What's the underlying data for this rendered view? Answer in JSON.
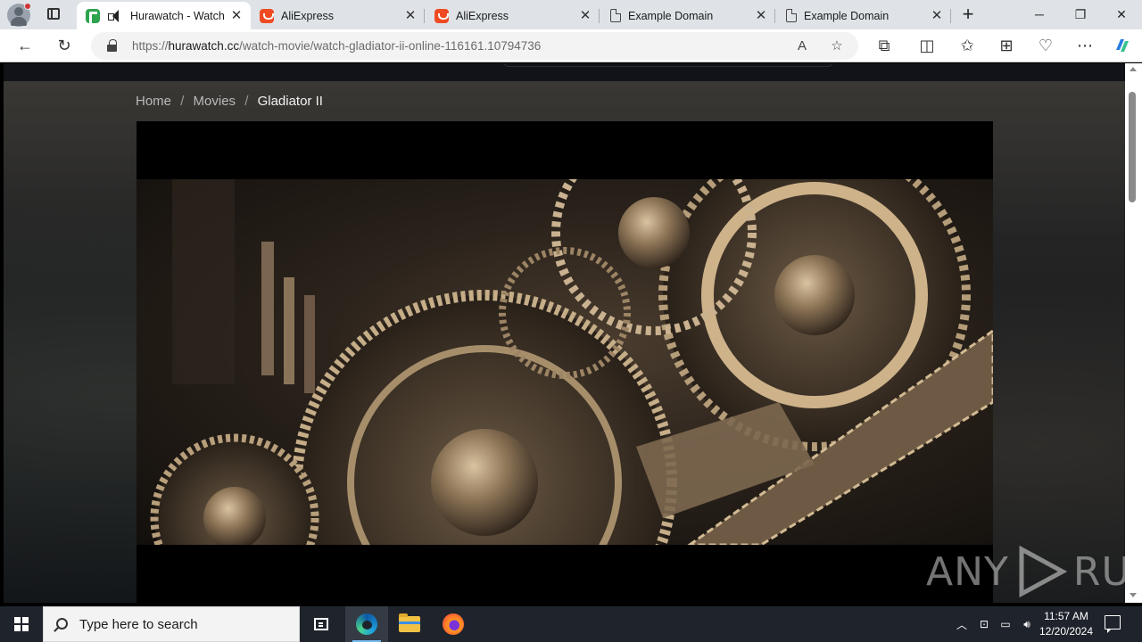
{
  "browser": {
    "tabs": [
      {
        "title": "Hurawatch - Watch",
        "icon": "hurawatch-favicon",
        "active": true,
        "audio": true
      },
      {
        "title": "AliExpress",
        "icon": "aliexpress-favicon",
        "active": false
      },
      {
        "title": "AliExpress",
        "icon": "aliexpress-favicon",
        "active": false
      },
      {
        "title": "Example Domain",
        "icon": "document-icon",
        "active": false
      },
      {
        "title": "Example Domain",
        "icon": "document-icon",
        "active": false
      }
    ],
    "address": {
      "scheme": "https://",
      "host": "hurawatch.cc",
      "path": "/watch-movie/watch-gladiator-ii-online-116161.10794736"
    }
  },
  "page": {
    "breadcrumb": [
      {
        "label": "Home"
      },
      {
        "label": "Movies"
      },
      {
        "label": "Gladiator II"
      }
    ],
    "breadcrumb_separator": "/",
    "watermark": {
      "left": "ANY",
      "right": "RUN"
    }
  },
  "taskbar": {
    "search_placeholder": "Type here to search",
    "time": "11:57 AM",
    "date": "12/20/2024"
  },
  "colors": {
    "tabstrip": "#dfe3e8",
    "taskbar": "#1f242c",
    "page_background": "#0b0b0d",
    "accent_taskbar": "#76b9ed"
  }
}
